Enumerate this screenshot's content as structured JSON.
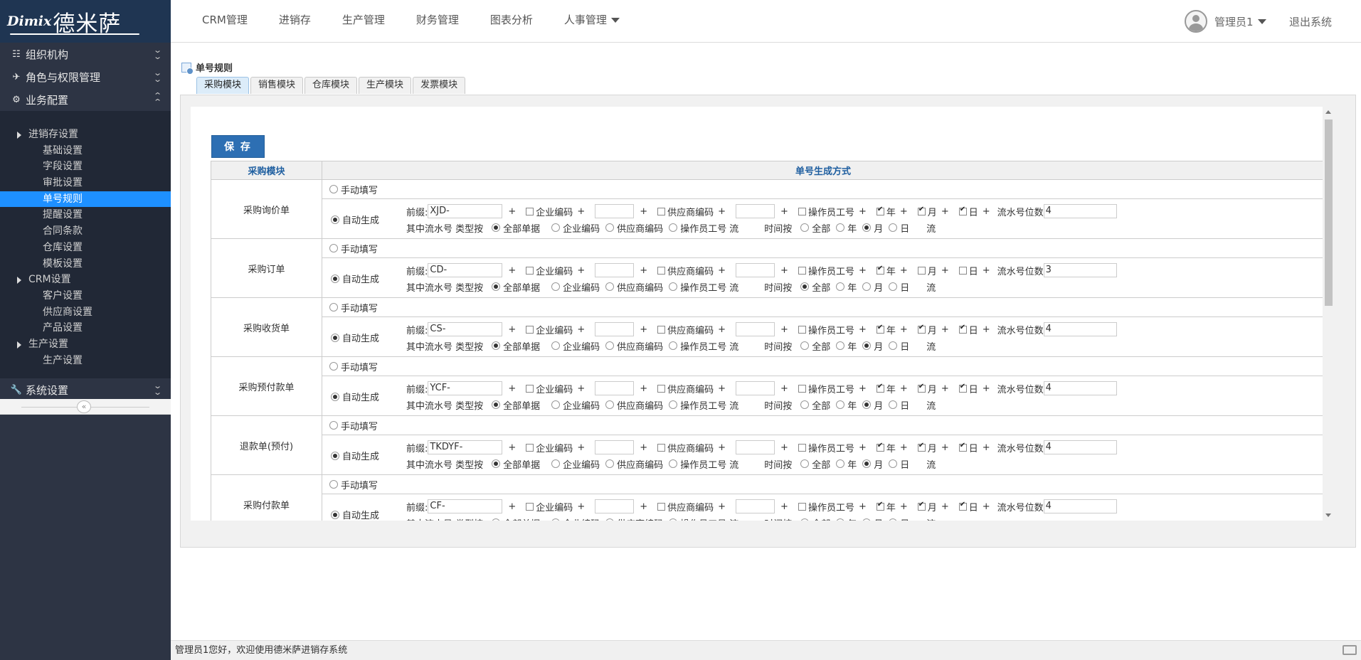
{
  "logo": {
    "en": "Dimix",
    "cn": "德米萨"
  },
  "topnav": {
    "items": [
      "CRM管理",
      "进销存",
      "生产管理",
      "财务管理",
      "图表分析",
      "人事管理"
    ],
    "user": "管理员1",
    "logout": "退出系统"
  },
  "sidebar": {
    "groups": [
      "组织机构",
      "角色与权限管理",
      "业务配置",
      "系统设置"
    ],
    "items": [
      "进销存设置",
      "基础设置",
      "字段设置",
      "审批设置",
      "单号规则",
      "提醒设置",
      "合同条款",
      "仓库设置",
      "模板设置",
      "CRM设置",
      "客户设置",
      "供应商设置",
      "产品设置",
      "生产设置",
      "生产设置"
    ],
    "active_index": 4
  },
  "page": {
    "title": "单号规则",
    "tabs": [
      "采购模块",
      "销售模块",
      "仓库模块",
      "生产模块",
      "发票模块"
    ],
    "active_tab": 0,
    "save": "保 存"
  },
  "table": {
    "headers": [
      "采购模块",
      "单号生成方式"
    ],
    "labels": {
      "manual": "手动填写",
      "auto": "自动生成",
      "prefix": "前缀:",
      "plus": "+",
      "company_code": "企业编码",
      "supplier_code": "供应商编码",
      "operator_id": "操作员工号",
      "year": "年",
      "month": "月",
      "day": "日",
      "serial_digits": "流水号位数",
      "serial_type": "其中流水号 类型按",
      "all_docs": "全部单据",
      "liu": "流",
      "time_by": "时间按",
      "all": "全部"
    },
    "rows": [
      {
        "name": "采购询价单",
        "prefix": "XJD-",
        "year": true,
        "month": true,
        "day": true,
        "digits": "4",
        "time": "month"
      },
      {
        "name": "采购订单",
        "prefix": "CD-",
        "year": true,
        "month": false,
        "day": false,
        "digits": "3",
        "time": "all"
      },
      {
        "name": "采购收货单",
        "prefix": "CS-",
        "year": true,
        "month": true,
        "day": true,
        "digits": "4",
        "time": "month"
      },
      {
        "name": "采购预付款单",
        "prefix": "YCF-",
        "year": true,
        "month": true,
        "day": true,
        "digits": "4",
        "time": "month"
      },
      {
        "name": "退款单(预付)",
        "prefix": "TKDYF-",
        "year": true,
        "month": true,
        "day": true,
        "digits": "4",
        "time": "month"
      },
      {
        "name": "采购付款单",
        "prefix": "CF-",
        "year": true,
        "month": true,
        "day": true,
        "digits": "4",
        "time": "month"
      }
    ]
  },
  "status": {
    "text": "管理员1您好，欢迎使用德米萨进销存系统"
  }
}
